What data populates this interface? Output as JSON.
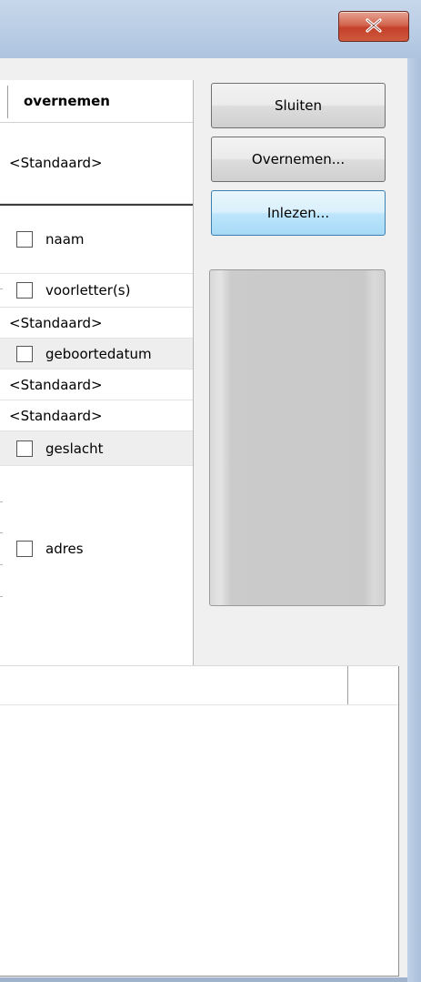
{
  "window": {
    "close_label": "X"
  },
  "grid": {
    "header": "overnemen",
    "rows": [
      {
        "kind": "standard",
        "text": "<Standaard>"
      },
      {
        "kind": "checkbox",
        "text": "naam"
      },
      {
        "kind": "checkbox",
        "text": "voorletter(s)"
      },
      {
        "kind": "standard",
        "text": "<Standaard>"
      },
      {
        "kind": "checkbox",
        "text": "geboortedatum"
      },
      {
        "kind": "standard",
        "text": "<Standaard>"
      },
      {
        "kind": "standard",
        "text": "<Standaard>"
      },
      {
        "kind": "checkbox",
        "text": "geslacht"
      },
      {
        "kind": "checkbox",
        "text": "adres"
      }
    ]
  },
  "buttons": {
    "sluiten": "Sluiten",
    "overnemen": "Overnemen...",
    "inlezen": "Inlezen..."
  },
  "colors": {
    "active_button_border": "#3c7fb1",
    "close_button": "#c4402a"
  }
}
